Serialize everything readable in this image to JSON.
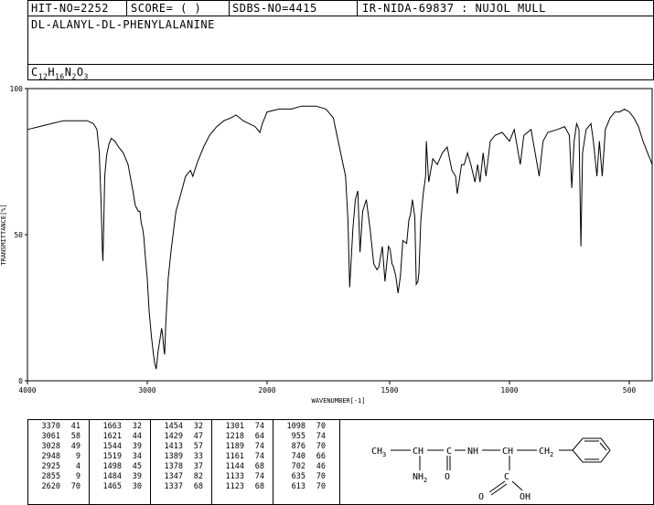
{
  "header": {
    "hit_no": "HIT-NO=2252",
    "score": "SCORE=  (   )",
    "sdbs_no": "SDBS-NO=4415",
    "ir_id": "IR-NIDA-69837 : NUJOL MULL",
    "compound_name": "DL-ALANYL-DL-PHENYLALANINE",
    "formula_parts": [
      "C",
      "12",
      "H",
      "16",
      "N",
      "2",
      "O",
      "3"
    ]
  },
  "chart_data": {
    "type": "line",
    "xlabel": "WAVENUMBER[-1]",
    "ylabel": "TRANSMITTANCE[%]",
    "xlim": [
      4000,
      400
    ],
    "ylim": [
      0,
      100
    ],
    "x_ticks": [
      "4000",
      "3000",
      "2000",
      "1500",
      "1000",
      "500"
    ],
    "y_ticks": [
      "100",
      "50",
      "0"
    ],
    "grid": false,
    "series": [
      {
        "color": "#000000",
        "points": [
          [
            4000,
            86
          ],
          [
            3900,
            87
          ],
          [
            3800,
            88
          ],
          [
            3700,
            89
          ],
          [
            3600,
            89
          ],
          [
            3500,
            89
          ],
          [
            3450,
            88
          ],
          [
            3420,
            86
          ],
          [
            3400,
            78
          ],
          [
            3385,
            60
          ],
          [
            3375,
            45
          ],
          [
            3370,
            41
          ],
          [
            3365,
            50
          ],
          [
            3355,
            70
          ],
          [
            3340,
            77
          ],
          [
            3320,
            81
          ],
          [
            3300,
            83
          ],
          [
            3270,
            82
          ],
          [
            3240,
            80
          ],
          [
            3200,
            78
          ],
          [
            3160,
            74
          ],
          [
            3120,
            65
          ],
          [
            3100,
            60
          ],
          [
            3075,
            58
          ],
          [
            3061,
            58
          ],
          [
            3050,
            54
          ],
          [
            3038,
            52
          ],
          [
            3028,
            49
          ],
          [
            3015,
            42
          ],
          [
            3000,
            35
          ],
          [
            2985,
            24
          ],
          [
            2965,
            15
          ],
          [
            2948,
            9
          ],
          [
            2938,
            6
          ],
          [
            2925,
            4
          ],
          [
            2910,
            10
          ],
          [
            2895,
            14
          ],
          [
            2880,
            18
          ],
          [
            2870,
            15
          ],
          [
            2862,
            11
          ],
          [
            2855,
            9
          ],
          [
            2845,
            20
          ],
          [
            2825,
            35
          ],
          [
            2800,
            45
          ],
          [
            2760,
            58
          ],
          [
            2720,
            64
          ],
          [
            2680,
            70
          ],
          [
            2640,
            72
          ],
          [
            2620,
            70
          ],
          [
            2580,
            75
          ],
          [
            2530,
            80
          ],
          [
            2480,
            84
          ],
          [
            2420,
            87
          ],
          [
            2360,
            89
          ],
          [
            2300,
            90
          ],
          [
            2260,
            91
          ],
          [
            2230,
            90
          ],
          [
            2200,
            89
          ],
          [
            2150,
            88
          ],
          [
            2100,
            87
          ],
          [
            2080,
            86
          ],
          [
            2060,
            85
          ],
          [
            2040,
            88
          ],
          [
            2000,
            92
          ],
          [
            1950,
            93
          ],
          [
            1900,
            93
          ],
          [
            1860,
            94
          ],
          [
            1820,
            94
          ],
          [
            1800,
            94
          ],
          [
            1760,
            93
          ],
          [
            1730,
            90
          ],
          [
            1700,
            78
          ],
          [
            1680,
            70
          ],
          [
            1670,
            55
          ],
          [
            1663,
            32
          ],
          [
            1650,
            52
          ],
          [
            1640,
            62
          ],
          [
            1630,
            65
          ],
          [
            1621,
            44
          ],
          [
            1610,
            58
          ],
          [
            1595,
            62
          ],
          [
            1580,
            52
          ],
          [
            1565,
            40
          ],
          [
            1552,
            38
          ],
          [
            1544,
            39
          ],
          [
            1530,
            46
          ],
          [
            1519,
            34
          ],
          [
            1505,
            46
          ],
          [
            1498,
            45
          ],
          [
            1490,
            40
          ],
          [
            1484,
            39
          ],
          [
            1475,
            36
          ],
          [
            1465,
            30
          ],
          [
            1455,
            36
          ],
          [
            1445,
            48
          ],
          [
            1429,
            47
          ],
          [
            1420,
            55
          ],
          [
            1413,
            57
          ],
          [
            1405,
            62
          ],
          [
            1395,
            56
          ],
          [
            1389,
            33
          ],
          [
            1382,
            34
          ],
          [
            1378,
            37
          ],
          [
            1370,
            55
          ],
          [
            1360,
            64
          ],
          [
            1350,
            70
          ],
          [
            1347,
            82
          ],
          [
            1337,
            68
          ],
          [
            1320,
            76
          ],
          [
            1301,
            74
          ],
          [
            1280,
            78
          ],
          [
            1260,
            80
          ],
          [
            1240,
            72
          ],
          [
            1225,
            70
          ],
          [
            1218,
            64
          ],
          [
            1200,
            74
          ],
          [
            1189,
            74
          ],
          [
            1175,
            78
          ],
          [
            1161,
            74
          ],
          [
            1144,
            68
          ],
          [
            1133,
            74
          ],
          [
            1123,
            68
          ],
          [
            1110,
            78
          ],
          [
            1098,
            70
          ],
          [
            1080,
            82
          ],
          [
            1060,
            84
          ],
          [
            1030,
            85
          ],
          [
            1000,
            82
          ],
          [
            980,
            86
          ],
          [
            955,
            74
          ],
          [
            940,
            84
          ],
          [
            910,
            86
          ],
          [
            876,
            70
          ],
          [
            860,
            82
          ],
          [
            840,
            85
          ],
          [
            800,
            86
          ],
          [
            770,
            87
          ],
          [
            750,
            84
          ],
          [
            740,
            66
          ],
          [
            730,
            82
          ],
          [
            720,
            88
          ],
          [
            710,
            86
          ],
          [
            702,
            46
          ],
          [
            695,
            78
          ],
          [
            680,
            86
          ],
          [
            660,
            88
          ],
          [
            650,
            82
          ],
          [
            635,
            70
          ],
          [
            625,
            82
          ],
          [
            613,
            70
          ],
          [
            600,
            86
          ],
          [
            580,
            90
          ],
          [
            560,
            92
          ],
          [
            540,
            92
          ],
          [
            520,
            93
          ],
          [
            500,
            92
          ],
          [
            480,
            90
          ],
          [
            460,
            87
          ],
          [
            440,
            82
          ],
          [
            420,
            78
          ],
          [
            405,
            75
          ],
          [
            400,
            74
          ]
        ]
      }
    ]
  },
  "peak_table": [
    [
      [
        "3370",
        "41"
      ],
      [
        "3061",
        "58"
      ],
      [
        "3028",
        "49"
      ],
      [
        "2948",
        "9"
      ],
      [
        "2925",
        "4"
      ],
      [
        "2855",
        "9"
      ],
      [
        "2620",
        "70"
      ]
    ],
    [
      [
        "1663",
        "32"
      ],
      [
        "1621",
        "44"
      ],
      [
        "1544",
        "39"
      ],
      [
        "1519",
        "34"
      ],
      [
        "1498",
        "45"
      ],
      [
        "1484",
        "39"
      ],
      [
        "1465",
        "30"
      ]
    ],
    [
      [
        "1454",
        "32"
      ],
      [
        "1429",
        "47"
      ],
      [
        "1413",
        "57"
      ],
      [
        "1389",
        "33"
      ],
      [
        "1378",
        "37"
      ],
      [
        "1347",
        "82"
      ],
      [
        "1337",
        "68"
      ]
    ],
    [
      [
        "1301",
        "74"
      ],
      [
        "1218",
        "64"
      ],
      [
        "1189",
        "74"
      ],
      [
        "1161",
        "74"
      ],
      [
        "1144",
        "68"
      ],
      [
        "1133",
        "74"
      ],
      [
        "1123",
        "68"
      ]
    ],
    [
      [
        "1098",
        "70"
      ],
      [
        "955",
        "74"
      ],
      [
        "876",
        "70"
      ],
      [
        "740",
        "66"
      ],
      [
        "702",
        "46"
      ],
      [
        "635",
        "70"
      ],
      [
        "613",
        "70"
      ]
    ]
  ],
  "structure": {
    "labels": [
      "CH3",
      "CH",
      "C",
      "NH",
      "CH",
      "CH2",
      "NH2",
      "O",
      "C",
      "O",
      "OH"
    ]
  }
}
